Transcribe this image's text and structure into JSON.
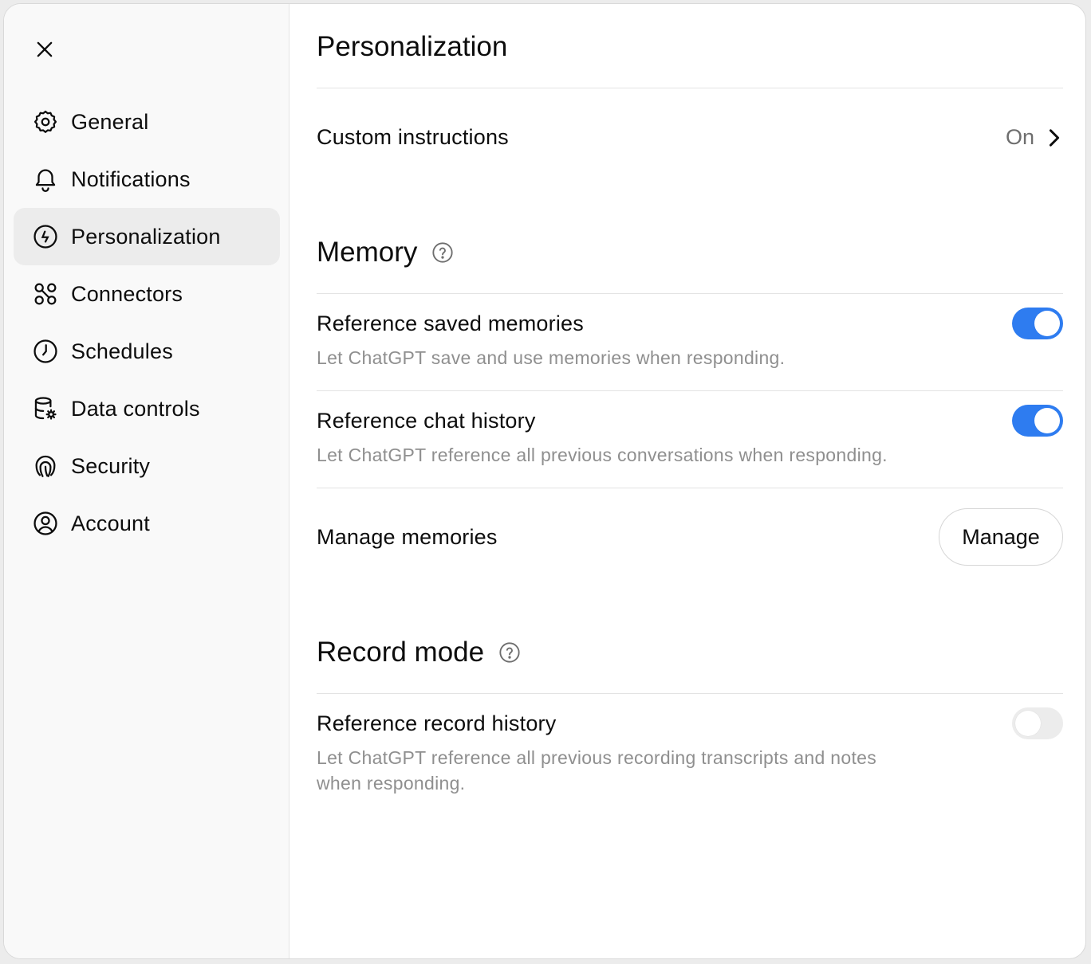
{
  "colors": {
    "accent": "#2e7cf0",
    "muted_text": "#8f8f8f",
    "sidebar_bg": "#f9f9f9",
    "active_bg": "#ececec"
  },
  "sidebar": {
    "close_icon": "close-icon",
    "items": [
      {
        "label": "General",
        "icon": "gear-icon"
      },
      {
        "label": "Notifications",
        "icon": "bell-icon"
      },
      {
        "label": "Personalization",
        "icon": "personalization-icon",
        "active": true
      },
      {
        "label": "Connectors",
        "icon": "connectors-icon"
      },
      {
        "label": "Schedules",
        "icon": "clock-icon"
      },
      {
        "label": "Data controls",
        "icon": "database-gear-icon"
      },
      {
        "label": "Security",
        "icon": "fingerprint-icon"
      },
      {
        "label": "Account",
        "icon": "user-circle-icon"
      }
    ]
  },
  "main": {
    "title": "Personalization",
    "custom_instructions": {
      "label": "Custom instructions",
      "value": "On"
    },
    "memory": {
      "section_title": "Memory",
      "saved_memories": {
        "label": "Reference saved memories",
        "description": "Let ChatGPT save and use memories when responding.",
        "enabled": true
      },
      "chat_history": {
        "label": "Reference chat history",
        "description": "Let ChatGPT reference all previous conversations when responding.",
        "enabled": true
      },
      "manage": {
        "label": "Manage memories",
        "button_label": "Manage"
      }
    },
    "record_mode": {
      "section_title": "Record mode",
      "record_history": {
        "label": "Reference record history",
        "description_line1": "Let ChatGPT reference all previous recording transcripts and notes",
        "description_line2": "when responding.",
        "enabled": false
      }
    }
  }
}
